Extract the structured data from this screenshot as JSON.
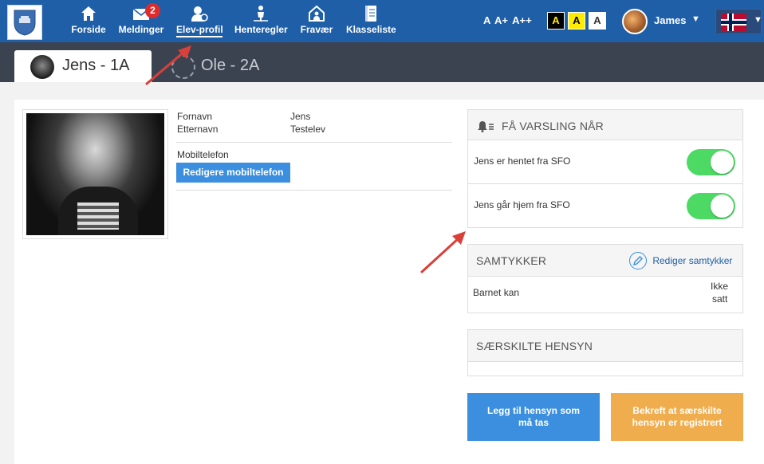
{
  "nav": {
    "items": [
      {
        "label": "Forside",
        "icon": "home-icon"
      },
      {
        "label": "Meldinger",
        "icon": "envelope-icon",
        "badge": "2"
      },
      {
        "label": "Elev-profil",
        "icon": "user-gear-icon",
        "active": true
      },
      {
        "label": "Henteregler",
        "icon": "pickup-icon"
      },
      {
        "label": "Fravær",
        "icon": "house-person-icon"
      },
      {
        "label": "Klasseliste",
        "icon": "notebook-icon"
      }
    ],
    "font_sizes": "A A+ A++",
    "contrast": [
      "A",
      "A",
      "A"
    ],
    "user": "James",
    "language_flag": "norway-flag-icon"
  },
  "students": [
    {
      "label": "Jens - 1A",
      "active": true
    },
    {
      "label": "Ole - 2A",
      "active": false
    }
  ],
  "profile": {
    "first_name_label": "Fornavn",
    "first_name": "Jens",
    "last_name_label": "Etternavn",
    "last_name": "Testelev",
    "mobile_label": "Mobiltelefon",
    "edit_mobile": "Redigere mobiltelefon"
  },
  "notify": {
    "title": "FÅ VARSLING NÅR",
    "rows": [
      {
        "label": "Jens er hentet fra SFO",
        "on": true
      },
      {
        "label": "Jens går hjem fra SFO",
        "on": true
      }
    ]
  },
  "consent": {
    "title": "SAMTYKKER",
    "edit": "Rediger samtykker",
    "row_label": "Barnet kan",
    "row_value_1": "Ikke",
    "row_value_2": "satt"
  },
  "special": {
    "title": "SÆRSKILTE HENSYN"
  },
  "actions": {
    "add": "Legg til hensyn som må tas",
    "confirm": "Bekreft at særskilte hensyn er registrert"
  },
  "colors": {
    "nav_bg": "#1f5fa8",
    "tabbar_bg": "#3c4350",
    "primary": "#3b8fde",
    "warning": "#f0ad4e",
    "toggle_on": "#4cd964",
    "arrow": "#d9403a"
  }
}
